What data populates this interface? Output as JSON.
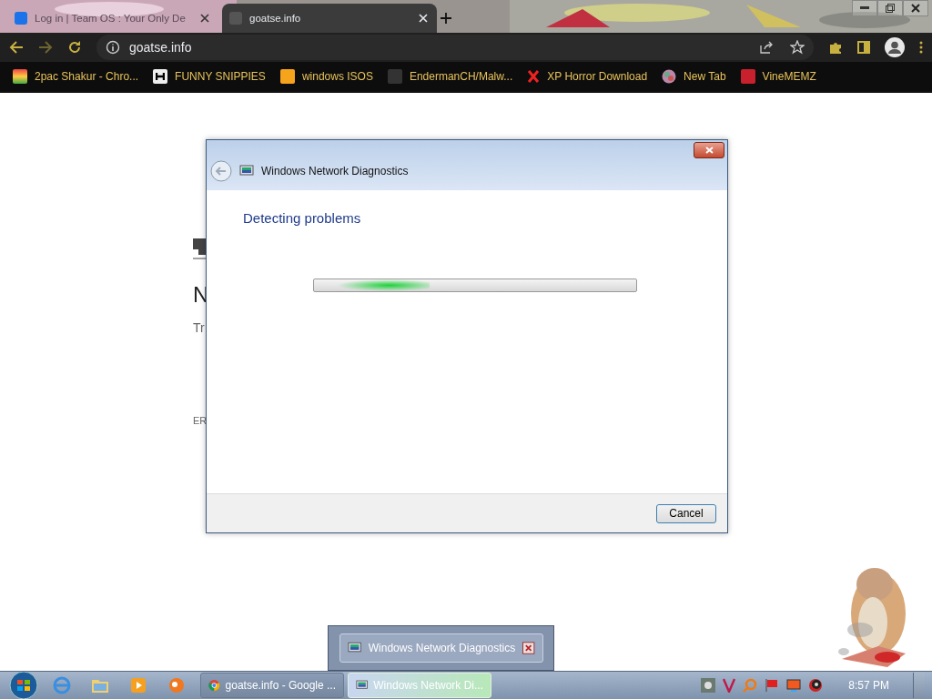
{
  "browser": {
    "tabs": [
      {
        "title": "Log in | Team OS : Your Only De",
        "selected": false
      },
      {
        "title": "goatse.info",
        "selected": true
      }
    ],
    "address": "goatse.info",
    "bookmarks": [
      {
        "label": "2pac Shakur - Chro...",
        "kind": "bag"
      },
      {
        "label": "FUNNY SNIPPIES",
        "kind": "h"
      },
      {
        "label": "windows ISOS",
        "kind": "ph"
      },
      {
        "label": "EndermanCH/Malw...",
        "kind": "yp"
      },
      {
        "label": "XP Horror Download",
        "kind": "x"
      },
      {
        "label": "New Tab",
        "kind": "globe"
      },
      {
        "label": "VineMEMZ",
        "kind": "r"
      }
    ]
  },
  "page_fragments": [
    "N",
    "Tr",
    "ER"
  ],
  "dialog": {
    "title": "Windows Network Diagnostics",
    "heading": "Detecting problems",
    "progress": {
      "level": 0.36
    },
    "button": "Cancel"
  },
  "taskbar": {
    "preview": {
      "title": "Windows Network Diagnostics"
    },
    "buttons": [
      {
        "label": "goatse.info - Google ...",
        "kind": "chrome",
        "selected": false
      },
      {
        "label": "Windows Network Di...",
        "kind": "network",
        "selected": true
      }
    ],
    "clock": "8:57 PM"
  }
}
